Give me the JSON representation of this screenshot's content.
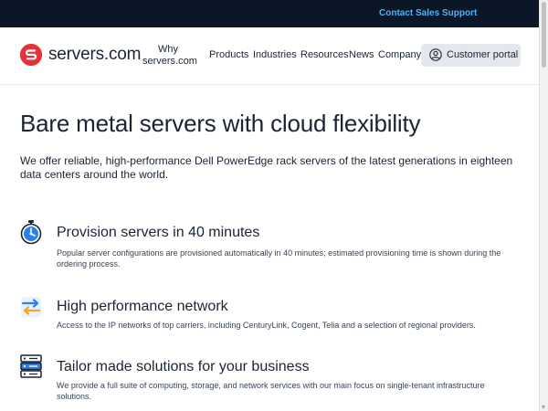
{
  "topbar": {
    "contact_sales": "Contact Sales",
    "support": "Support"
  },
  "header": {
    "logo_text": "servers.com",
    "nav": {
      "why_line1": "Why",
      "why_line2": "servers.com",
      "products": "Products",
      "industries": "Industries",
      "resources": "Resources",
      "news": "News",
      "company": "Company"
    },
    "portal_label": "Customer portal"
  },
  "hero": {
    "title": "Bare metal servers with cloud flexibility",
    "description": "We offer reliable, high-performance Dell PowerEdge rack servers of the latest generations in eighteen data centers around the world."
  },
  "features": [
    {
      "icon": "stopwatch-icon",
      "title": "Provision servers in 40 minutes",
      "description": "Popular server configurations are provisioned automatically in 40 minutes; estimated provisioning time is shown during the ordering process."
    },
    {
      "icon": "network-transfer-icon",
      "title": "High performance network",
      "description": "Access to the IP networks of top carriers, including CenturyLink, Cogent, Telia and a selection of regional providers."
    },
    {
      "icon": "server-rack-icon",
      "title": "Tailor made solutions for your business",
      "description": "We provide a full suite of computing, storage, and network services with our main focus on single-tenant infrastructure solutions."
    }
  ],
  "colors": {
    "topbar_bg": "#0b1626",
    "topbar_link": "#4fb3f4",
    "brand_red": "#e53238",
    "portal_bg": "#e4e7ec",
    "icon_blue": "#2f80ed",
    "icon_orange": "#f5a623",
    "text": "#1b2435"
  }
}
